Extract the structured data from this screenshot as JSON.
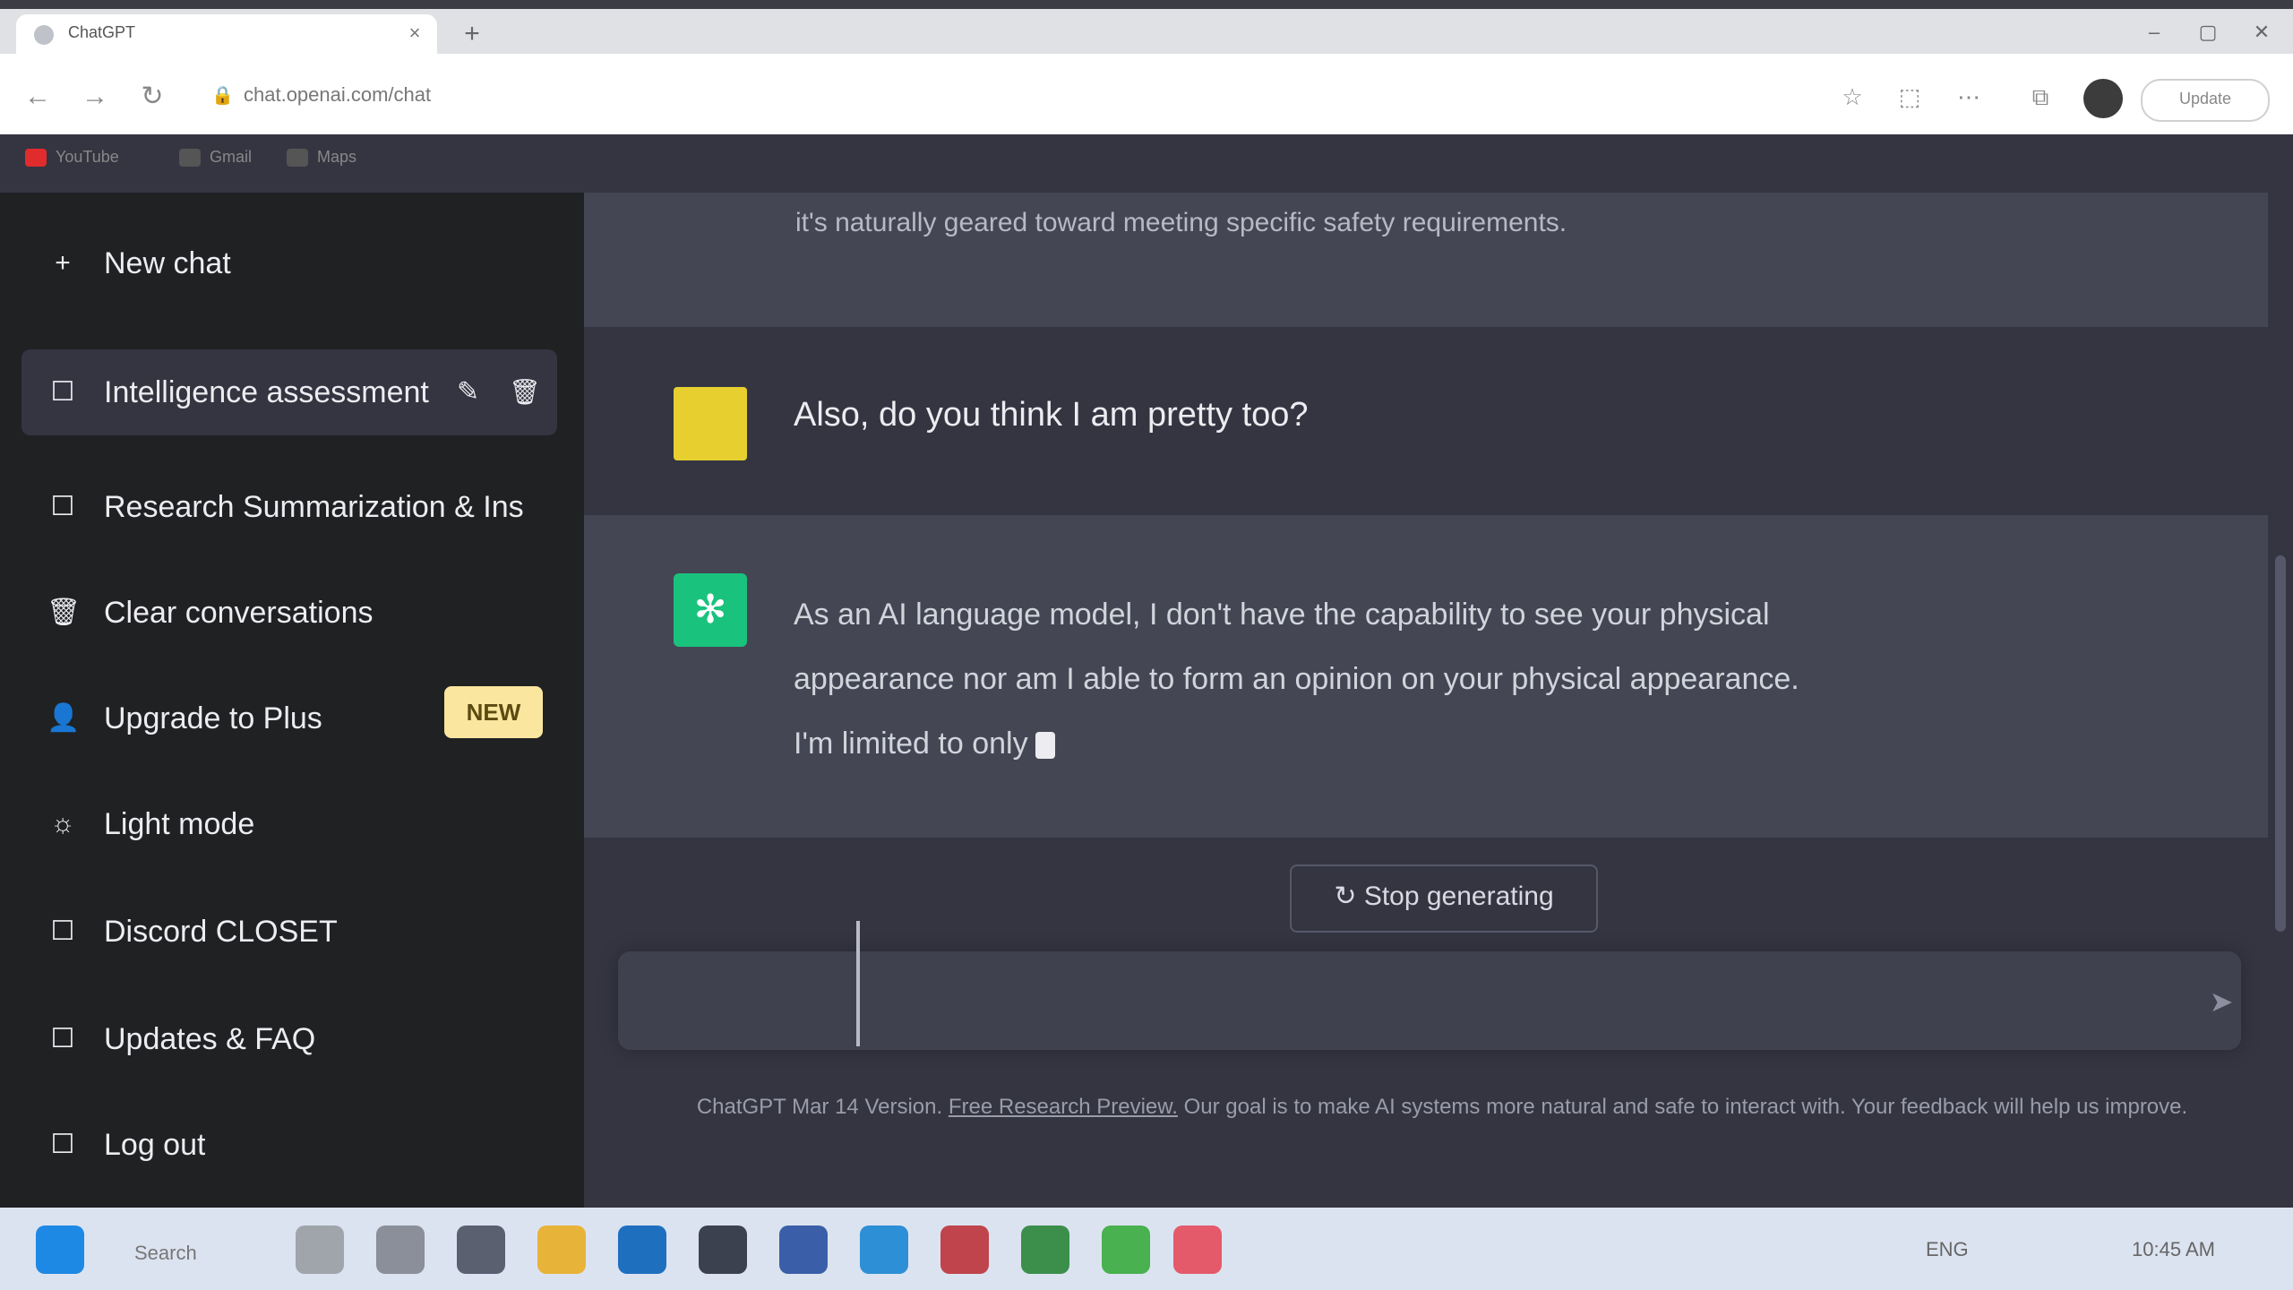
{
  "browser": {
    "tab_title": "ChatGPT",
    "tab_close": "×",
    "new_tab": "+",
    "window_controls": [
      "–",
      "▢",
      "✕"
    ],
    "nav": {
      "back": "←",
      "forward": "→",
      "reload": "↻"
    },
    "url": "chat.openai.com/chat",
    "lock_icon": "🔒",
    "toolbar_icons": [
      "☆",
      "⬚",
      "⋯",
      "⧉"
    ],
    "update_label": "Update",
    "bookmarks": [
      {
        "label": "YouTube",
        "color": "#e02c2c"
      },
      {
        "label": "Gmail",
        "color": "#555555"
      },
      {
        "label": "Maps",
        "color": "#555555"
      }
    ]
  },
  "sidebar": {
    "new_chat": {
      "icon": "+",
      "label": "New chat"
    },
    "chats": [
      {
        "icon": "☐",
        "label": "Intelligence assessment",
        "edit": "✎",
        "delete": "🗑"
      },
      {
        "icon": "☐",
        "label": "Research Summarization & Ins"
      }
    ],
    "items": [
      {
        "icon": "🗑",
        "label": "Clear conversations"
      },
      {
        "icon": "👤",
        "label": "Upgrade to Plus",
        "badge": "NEW"
      },
      {
        "icon": "☼",
        "label": "Light mode"
      },
      {
        "icon": "☐",
        "label": "Discord CLOSET"
      },
      {
        "icon": "☐",
        "label": "Updates & FAQ"
      },
      {
        "icon": "☐",
        "label": "Log out"
      }
    ]
  },
  "conversation": {
    "previous_text": "it's naturally geared toward meeting specific safety requirements.",
    "user_message": "Also, do you think I am pretty too?",
    "assistant_lines": [
      "As an AI language model, I don't have the capability to see your physical",
      "appearance nor am I able to form an opinion on your physical appearance.",
      "I'm limited to only"
    ],
    "regenerate_label": "↻ Stop generating",
    "send_icon": "➤",
    "footer_prefix": "ChatGPT Mar 14 Version.",
    "footer_link": "Free Research Preview.",
    "footer_suffix": "Our goal is to make AI systems more natural and safe to interact with. Your feedback will help us improve."
  },
  "taskbar": {
    "search_label": "Search",
    "icons": [
      {
        "name": "windows-start-icon",
        "color": "#1e88e5"
      },
      {
        "name": "weather-icon",
        "color": "#a0a4ab"
      },
      {
        "name": "pen-icon",
        "color": "#8a8f99"
      },
      {
        "name": "task-view-icon",
        "color": "#5a6070"
      },
      {
        "name": "file-explorer-icon",
        "color": "#e8b339"
      },
      {
        "name": "edge-icon",
        "color": "#1f6fbf"
      },
      {
        "name": "calculator-icon",
        "color": "#3c4150"
      },
      {
        "name": "store-icon",
        "color": "#3a5fa8"
      },
      {
        "name": "telegram-icon",
        "color": "#2d8fd5"
      },
      {
        "name": "app-icon-red",
        "color": "#c0444b"
      },
      {
        "name": "app-icon-green",
        "color": "#3b8f4b"
      },
      {
        "name": "app-icon-lime",
        "color": "#49b14f"
      },
      {
        "name": "app-icon-pink",
        "color": "#e45a6a"
      }
    ],
    "tray_text": "ENG",
    "clock": "10:45 AM"
  }
}
